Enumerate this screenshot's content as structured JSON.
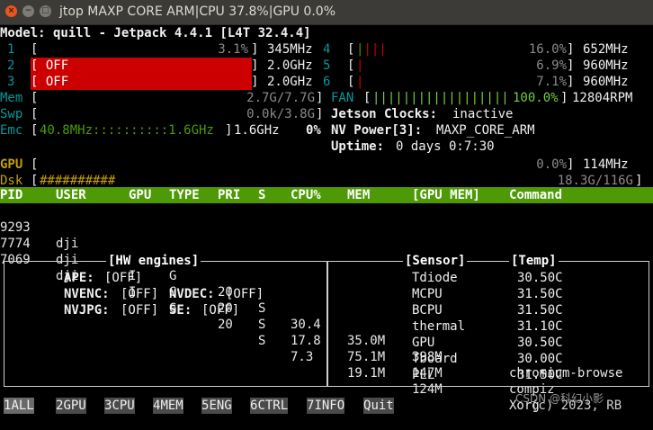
{
  "window": {
    "title": "jtop MAXP CORE ARM|CPU 37.8%|GPU 0.0%"
  },
  "model_line": "Model: quill - Jetpack 4.4.1 [L4T 32.4.4]",
  "cpus": [
    {
      "id": "1",
      "bar": "",
      "off": false,
      "value": "3.1%",
      "freq": "345MHz"
    },
    {
      "id": "2",
      "off": true,
      "off_label": "OFF",
      "freq": "2.0GHz"
    },
    {
      "id": "3",
      "off": true,
      "off_label": "OFF",
      "freq": "2.0GHz"
    },
    {
      "id": "4",
      "bar": "||||",
      "off": false,
      "value": "16.0%",
      "freq": "652MHz"
    },
    {
      "id": "5",
      "bar": "|",
      "off": false,
      "value": "6.9%",
      "freq": "960MHz"
    },
    {
      "id": "6",
      "bar": "|",
      "off": false,
      "value": "7.1%",
      "freq": "960MHz"
    }
  ],
  "mem": {
    "label": "Mem",
    "value": "2.7G/7.7G"
  },
  "swp": {
    "label": "Swp",
    "value": "0.0k/3.8G"
  },
  "emc": {
    "label": "Emc",
    "bar": "40.8MHz::::::::::1.6GHz",
    "freq": "1.6GHz",
    "pct": "0%"
  },
  "fan": {
    "label": "FAN",
    "bar": "||||||||||||||||||",
    "value": "100.0%",
    "rpm": "12804RPM"
  },
  "jetson_clocks": {
    "label": "Jetson Clocks:",
    "value": "inactive"
  },
  "nv_power": {
    "label": "NV Power[3]:",
    "value": "MAXP_CORE_ARM"
  },
  "uptime": {
    "label": "Uptime:",
    "value": "0 days 0:7:30"
  },
  "gpu": {
    "label": "GPU",
    "value": "0.0%",
    "freq": "114MHz"
  },
  "dsk": {
    "label": "Dsk",
    "bar": "##########",
    "value": "18.3G/116G"
  },
  "process_table": {
    "headers": [
      "PID",
      "USER",
      "GPU",
      "TYPE",
      "PRI",
      "S",
      "CPU%",
      "MEM",
      "[GPU MEM]",
      "Command"
    ],
    "rows": [
      [
        "9293",
        "dji",
        "I",
        "G",
        "20",
        "S",
        "30.4",
        "35.0M",
        "398M",
        "chromium-browse"
      ],
      [
        "7774",
        "dji",
        "I",
        "G",
        "20",
        "S",
        "17.8",
        "75.1M",
        "147M",
        "compiz"
      ],
      [
        "7069",
        "dji",
        "I",
        "G",
        "20",
        "S",
        "7.3",
        "19.1M",
        "124M",
        "Xorg"
      ]
    ]
  },
  "hw_engines": {
    "title": "[HW engines]",
    "ape": {
      "label": "APE:",
      "value": "[OFF]"
    },
    "nvenc": {
      "label": "NVENC:",
      "value": "[OFF]"
    },
    "nvdec": {
      "label": "NVDEC:",
      "value": "[OFF]"
    },
    "nvjpg": {
      "label": "NVJPG:",
      "value": "[OFF]"
    },
    "se": {
      "label": "SE:",
      "value": "[OFF]"
    }
  },
  "sensors": {
    "sensor_title": "[Sensor]",
    "temp_title": "[Temp]",
    "rows": [
      [
        "Tdiode",
        "30.50C"
      ],
      [
        "MCPU",
        "31.50C"
      ],
      [
        "BCPU",
        "31.50C"
      ],
      [
        "thermal",
        "31.10C"
      ],
      [
        "GPU",
        "30.50C"
      ],
      [
        "Tboard",
        "30.00C"
      ],
      [
        "PLL",
        "31.50C"
      ]
    ]
  },
  "footer": {
    "tabs": [
      {
        "num": "1",
        "label": "ALL"
      },
      {
        "num": "2",
        "label": "GPU"
      },
      {
        "num": "3",
        "label": "CPU"
      },
      {
        "num": "4",
        "label": "MEM"
      },
      {
        "num": "5",
        "label": "ENG"
      },
      {
        "num": "6",
        "label": "CTRL"
      },
      {
        "num": "7",
        "label": "INFO"
      }
    ],
    "quit": {
      "num": "Q",
      "label": "uit"
    },
    "copyright": "(c) 2023, RB",
    "watermark": "CSDN @科幻小影"
  },
  "colors": {
    "accent_green": "#4e9a06",
    "off_red": "#cc0000",
    "titlebar": "#3c3b37"
  }
}
